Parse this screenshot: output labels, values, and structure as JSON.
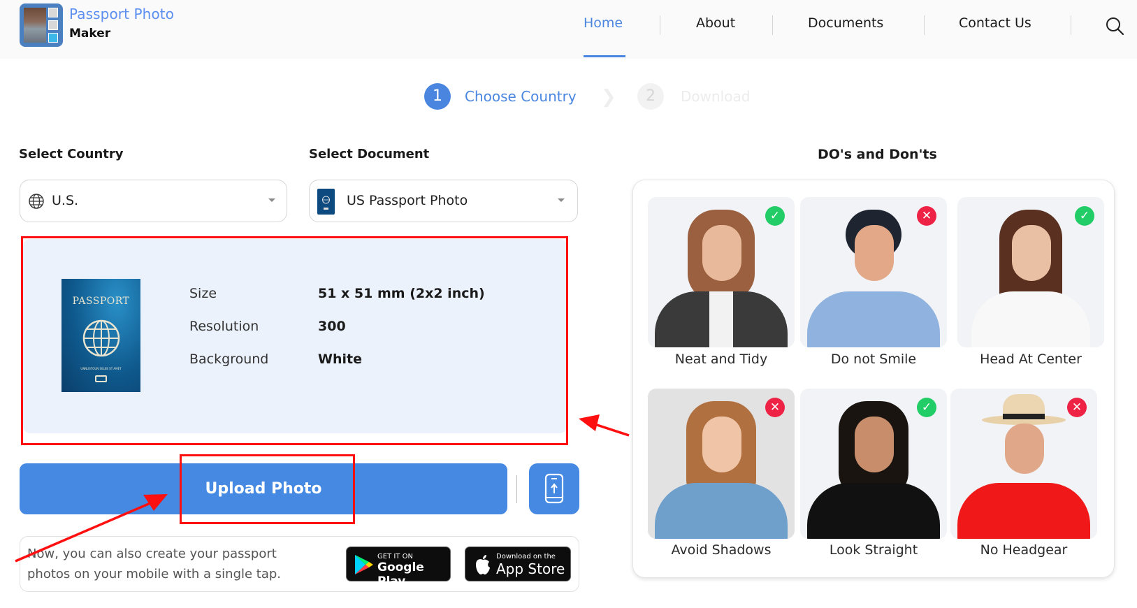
{
  "header": {
    "brand_line1": "Passport Photo",
    "brand_line2": "Maker",
    "nav": [
      {
        "label": "Home",
        "active": true
      },
      {
        "label": "About",
        "active": false
      },
      {
        "label": "Documents",
        "active": false
      },
      {
        "label": "Contact Us",
        "active": false
      }
    ],
    "search_icon": "search-icon"
  },
  "stepper": {
    "steps": [
      {
        "number": "1",
        "label": "Choose Country",
        "active": true
      },
      {
        "number": "2",
        "label": "Download",
        "active": false
      }
    ]
  },
  "form": {
    "country_label": "Select Country",
    "country_value": "U.S.",
    "document_label": "Select Document",
    "document_value": "US Passport Photo"
  },
  "spec": {
    "passport_cover_text": "PASSPORT",
    "passport_cover_small": "UNNUSTOUN SELEE ST AMET",
    "rows": [
      {
        "label": "Size",
        "value": "51 x 51 mm (2x2 inch)"
      },
      {
        "label": "Resolution",
        "value": "300"
      },
      {
        "label": "Background",
        "value": "White"
      }
    ]
  },
  "actions": {
    "upload_label": "Upload Photo",
    "mobile_upload_icon": "mobile-upload-icon"
  },
  "app_promo": {
    "text": "Now, you can also create your passport photos on your mobile with a single tap.",
    "google_small": "GET IT ON",
    "google_big": "Google Play",
    "apple_small": "Download on the",
    "apple_big": "App Store"
  },
  "dos_donts": {
    "title": "DO's and Don'ts",
    "items": [
      {
        "caption": "Neat and Tidy",
        "status": "do"
      },
      {
        "caption": "Do not Smile",
        "status": "dont"
      },
      {
        "caption": "Head At Center",
        "status": "do"
      },
      {
        "caption": "Avoid Shadows",
        "status": "dont"
      },
      {
        "caption": "Look Straight",
        "status": "do"
      },
      {
        "caption": "No Headgear",
        "status": "dont"
      }
    ]
  },
  "colors": {
    "accent": "#4689e2",
    "do_badge": "#22cc66",
    "dont_badge": "#ee2244",
    "annotation_red": "#ff1010",
    "panel_bg": "#ecf2fc"
  }
}
